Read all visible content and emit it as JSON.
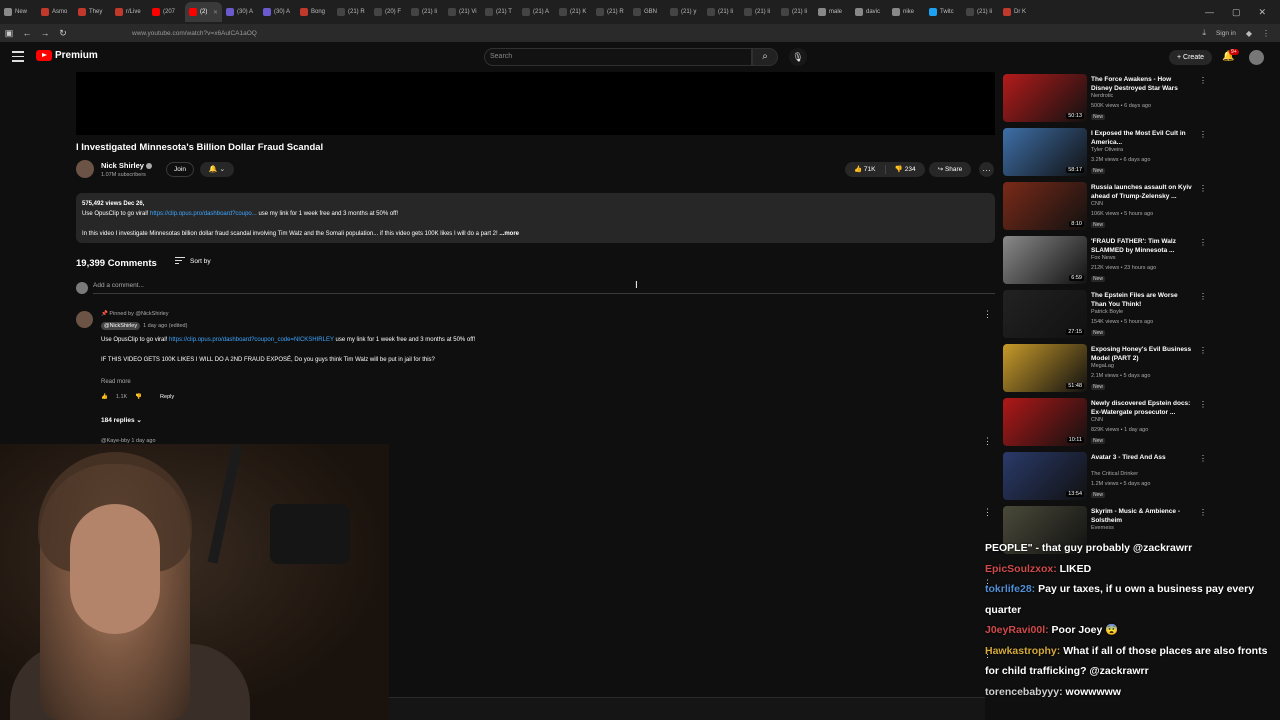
{
  "browser": {
    "tabs": [
      {
        "label": "New",
        "color": "#8a8a8a"
      },
      {
        "label": "Asmo",
        "color": "#c0392b"
      },
      {
        "label": "They",
        "color": "#c0392b"
      },
      {
        "label": "r/Live",
        "color": "#c0392b"
      },
      {
        "label": "(207",
        "color": "#ff0000"
      },
      {
        "label": "(2)",
        "color": "#ff0000",
        "active": true
      },
      {
        "label": "(30) A",
        "color": "#6a5acd"
      },
      {
        "label": "(30) A",
        "color": "#6a5acd"
      },
      {
        "label": "Bong",
        "color": "#c0392b"
      },
      {
        "label": "(21) R",
        "color": "#444"
      },
      {
        "label": "(20) F",
        "color": "#444"
      },
      {
        "label": "(21) li",
        "color": "#444"
      },
      {
        "label": "(21) Vi",
        "color": "#444"
      },
      {
        "label": "(21) T",
        "color": "#444"
      },
      {
        "label": "(21) A",
        "color": "#444"
      },
      {
        "label": "(21) K",
        "color": "#444"
      },
      {
        "label": "(21) R",
        "color": "#444"
      },
      {
        "label": "GBN",
        "color": "#444"
      },
      {
        "label": "(21) y",
        "color": "#444"
      },
      {
        "label": "(21) li",
        "color": "#444"
      },
      {
        "label": "(21) li",
        "color": "#444"
      },
      {
        "label": "(21) li",
        "color": "#444"
      },
      {
        "label": "male",
        "color": "#888"
      },
      {
        "label": "davic",
        "color": "#888"
      },
      {
        "label": "nike",
        "color": "#888"
      },
      {
        "label": "Twitc",
        "color": "#1da1f2"
      },
      {
        "label": "(21) li",
        "color": "#444"
      },
      {
        "label": "Dr K",
        "color": "#c0392b"
      }
    ],
    "url": "www.youtube.com/watch?v=x6AulCA1aOQ",
    "sign_in": "Sign in"
  },
  "header": {
    "brand": "Premium",
    "search_placeholder": "Search",
    "create_label": "Create",
    "notif_badge": "9+"
  },
  "video": {
    "title": "I Investigated Minnesota's Billion Dollar Fraud Scandal",
    "channel": "Nick Shirley",
    "subscribers": "1.07M subscribers",
    "join_label": "Join",
    "likes": "71K",
    "dislikes": "234",
    "share_label": "Share",
    "views_date": "575,492 views  Dec 26,",
    "desc_line1_prefix": "Use OpusClip to go viral! ",
    "desc_line1_link": "https://clip.opus.pro/dashboard?coupo...",
    "desc_line1_suffix": " use my link for 1 week free and 3 months at 50% off!",
    "desc_line2": "In this video I investigate Minnesotas billion dollar fraud scandal involving Tim Walz and the Somali population... if this video gets 100K likes I will do a part 2!",
    "desc_more": "...more"
  },
  "comments": {
    "count": "19,399 Comments",
    "sort_label": "Sort by",
    "add_placeholder": "Add a comment...",
    "pinned_label": "Pinned by @NickShirley",
    "author": "@NickShirley",
    "time": "1 day ago (edited)",
    "body1_prefix": "Use OpusClip to go viral! ",
    "body1_link": "https://clip.opus.pro/dashboard?coupon_code=NICKSHIRLEY",
    "body1_suffix": " use my link for 1 week free and 3 months at 50% off!",
    "body2": "IF THIS VIDEO GETS 100K LIKES I WILL DO A 2ND FRAUD EXPOSÉ, Do you guys think Tim Walz will be put in jail for this?",
    "read_more": "Read more",
    "likes": "1.1K",
    "reply_label": "Reply",
    "replies": "184 replies",
    "next_author": "@Kaye-bby  1 day ago"
  },
  "sidebar": [
    {
      "title": "The Force Awakens - How Disney Destroyed Star Wars",
      "channel": "Nerdrotic",
      "meta": "500K views • 6 days ago",
      "badge": "New",
      "duration": "50:13",
      "thumb": "#b31b1b"
    },
    {
      "title": "I Exposed the Most Evil Cult in America...",
      "channel": "Tyler Oliveira",
      "meta": "3.2M views • 6 days ago",
      "badge": "New",
      "duration": "58:17",
      "thumb": "#3e6fa8"
    },
    {
      "title": "Russia launches assault on Kyiv ahead of Trump-Zelensky ...",
      "channel": "CNN",
      "meta": "106K views • 5 hours ago",
      "badge": "New",
      "duration": "8:10",
      "thumb": "#7a2a18"
    },
    {
      "title": "'FRAUD FATHER': Tim Walz SLAMMED by Minnesota ...",
      "channel": "Fox News",
      "meta": "212K views • 23 hours ago",
      "badge": "New",
      "duration": "6:59",
      "thumb": "#8a8a8a"
    },
    {
      "title": "The Epstein Files are Worse Than You Think!",
      "channel": "Patrick Boyle",
      "meta": "154K views • 5 hours ago",
      "badge": "New",
      "duration": "27:15",
      "thumb": "#222222"
    },
    {
      "title": "Exposing Honey's Evil Business Model (PART 2)",
      "channel": "MegaLag",
      "meta": "2.1M views • 5 days ago",
      "badge": "New",
      "duration": "51:48",
      "thumb": "#c79a2a"
    },
    {
      "title": "Newly discovered Epstein docs: Ex-Watergate prosecutor ...",
      "channel": "CNN",
      "meta": "829K views • 1 day ago",
      "badge": "New",
      "duration": "10:11",
      "thumb": "#b01818"
    },
    {
      "title": "Avatar 3 - Tired And Ass",
      "channel": "The Critical Drinker",
      "meta": "1.2M views • 5 days ago",
      "badge": "New",
      "duration": "13:54",
      "thumb": "#2a3a6a"
    },
    {
      "title": "Skyrim - Music & Ambience - Solstheim",
      "channel": "Everness",
      "meta": "",
      "badge": "",
      "duration": "",
      "thumb": "#4a4a3a"
    }
  ],
  "chat": [
    {
      "user": "",
      "user_color": "#ffffff",
      "text": "PEOPLE\" - that guy probably @zackrawrr"
    },
    {
      "user": "EpicSoulzxox:",
      "user_color": "#d04a4a",
      "text": " LIKED"
    },
    {
      "user": "tokrlife28:",
      "user_color": "#4f8fd6",
      "text": " Pay ur taxes, if u own a business pay every quarter"
    },
    {
      "user": "J0eyRavi00l:",
      "user_color": "#d04a4a",
      "text": " Poor Joey 😨"
    },
    {
      "user": "Hawkastrophy:",
      "user_color": "#d4a93a",
      "text": " What if all of those places are also fronts for child trafficking? @zackrawrr"
    },
    {
      "user": "torencebabyyy:",
      "user_color": "#cfcfcf",
      "text": " wowwwww"
    }
  ]
}
